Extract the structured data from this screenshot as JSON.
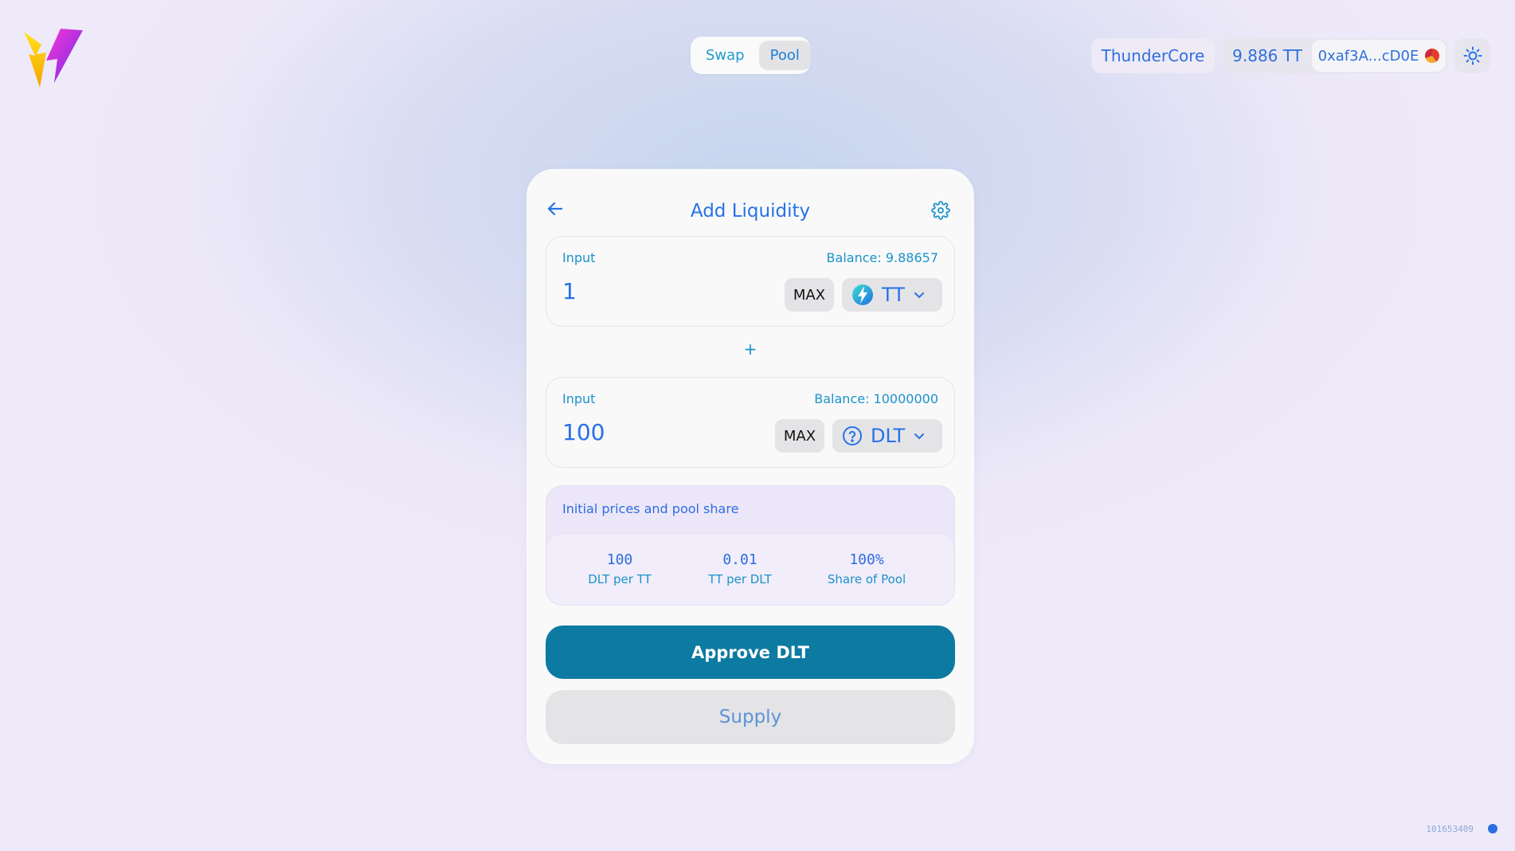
{
  "nav": {
    "tabs": [
      {
        "label": "Swap",
        "active": false
      },
      {
        "label": "Pool",
        "active": true
      }
    ]
  },
  "header": {
    "network": "ThunderCore",
    "balance": "9.886 TT",
    "address": "0xaf3A...cD0E"
  },
  "card": {
    "title": "Add Liquidity",
    "input_a": {
      "label": "Input",
      "balance": "Balance: 9.88657",
      "amount": "1",
      "max_label": "MAX",
      "token": "TT",
      "token_icon": "thundercore-icon"
    },
    "plus": "+",
    "input_b": {
      "label": "Input",
      "balance": "Balance: 10000000",
      "amount": "100",
      "max_label": "MAX",
      "token": "DLT",
      "token_icon": "question-circle-icon"
    },
    "prices": {
      "title": "Initial prices and pool share",
      "items": [
        {
          "value": "100",
          "label": "DLT per TT"
        },
        {
          "value": "0.01",
          "label": "TT per DLT"
        },
        {
          "value": "100%",
          "label": "Share of Pool"
        }
      ]
    },
    "approve_label": "Approve DLT",
    "supply_label": "Supply"
  },
  "footer": {
    "block_number": "101653409"
  },
  "colors": {
    "accent": "#2672e6",
    "teal": "#0d7aa2",
    "secondary": "#1b93c7"
  }
}
